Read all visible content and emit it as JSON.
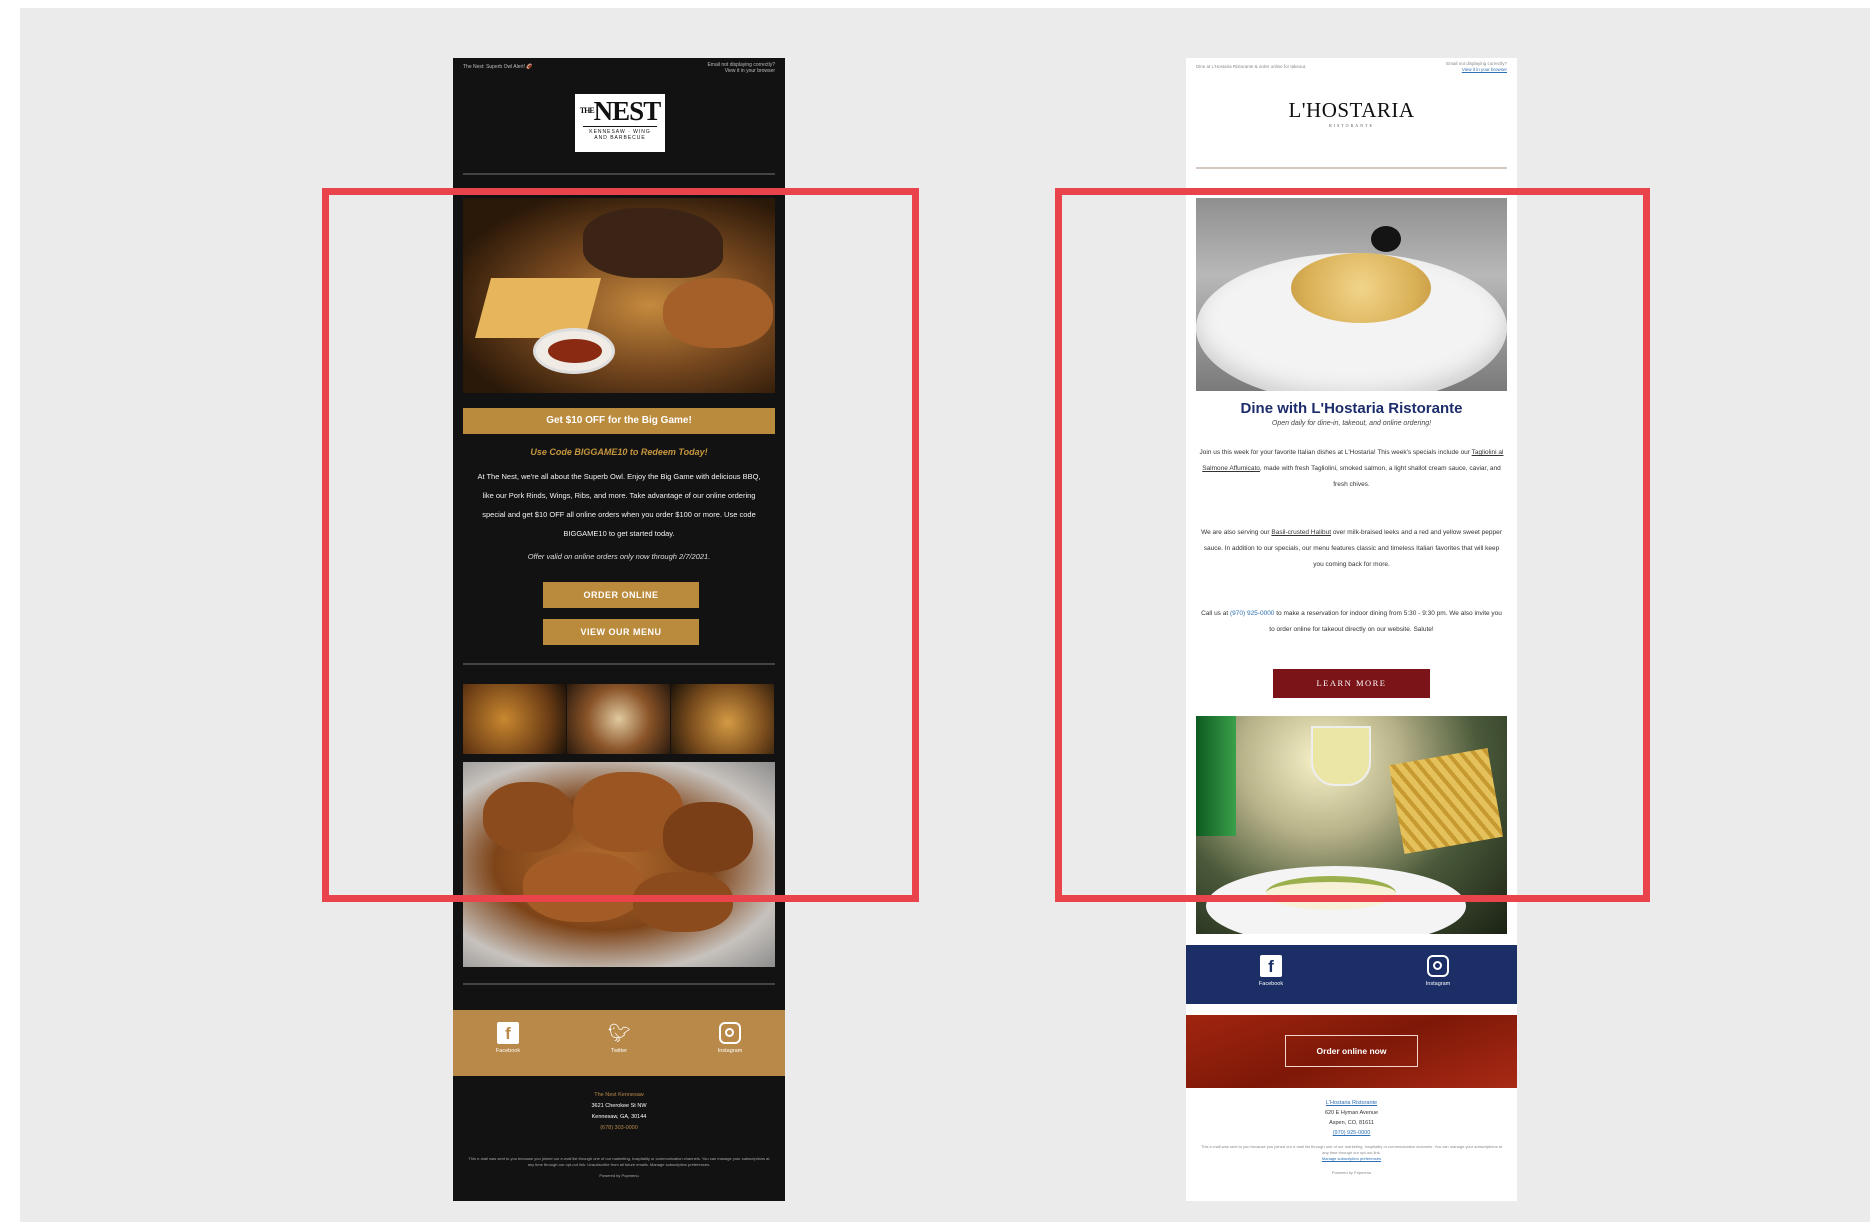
{
  "colors": {
    "background": "#ebebeb",
    "nest_bg": "#121212",
    "nest_gold": "#bb8b3d",
    "host_navy": "#1b2f66",
    "host_maroon": "#7a1419",
    "highlight_frame": "#e9434c"
  },
  "nest": {
    "preheader_left": "The Nest: Superb Owl Alert! 🏈",
    "preheader_right_1": "Email not displaying correctly?",
    "preheader_right_2": "View it in your browser",
    "logo_main": "NEST",
    "logo_the": "THE",
    "logo_sub": "KENNESAW · WING AND BARBECUE",
    "promo_bar": "Get $10 OFF for the Big Game!",
    "code_line": "Use Code BIGGAME10 to Redeem Today!",
    "body": "At The Nest, we're all about the Superb Owl. Enjoy the Big Game with delicious BBQ, like our Pork Rinds, Wings, Ribs, and more. Take advantage of our online ordering special and get $10 OFF all online orders when you order $100 or more. Use code BIGGAME10 to get started today.",
    "offer": "Offer valid on online orders only now through 2/7/2021.",
    "buttons": {
      "order": "ORDER ONLINE",
      "menu": "VIEW OUR MENU"
    },
    "social": {
      "facebook": "Facebook",
      "twitter": "Twitter",
      "instagram": "Instagram"
    },
    "footer": {
      "name": "The Nest Kennesaw",
      "address_1": "3621 Cherokee St NW",
      "address_2": "Kennesaw, GA, 30144",
      "phone": "(678) 303-0000"
    },
    "legal": "This e-mail was sent to you because you joined our e-mail list through one of our marketing, hospitality or communication channels. You can manage your subscriptions at any time through our opt-out link. Unsubscribe from all future emails. Manage subscription preferences.",
    "powered": "Powered by Popmenu"
  },
  "hostaria": {
    "preheader_left": "Dine at L'Hostaria Ristorante & order online for takeout.",
    "preheader_right_1": "Email not displaying correctly?",
    "preheader_right_2": "View it in your browser",
    "logo_name": "L'HOSTARIA",
    "logo_sub": "RISTORANTE",
    "title": "Dine with L'Hostaria Ristorante",
    "subtitle": "Open daily for dine-in, takeout, and online ordering!",
    "p1_a": "Join us this week for your favorite Italian dishes at L'Hostaria! This week's specials include our ",
    "p1_link": "Tagliolini al Salmone Affumicato",
    "p1_b": ", made with fresh Tagliolini, smoked salmon, a light shallot cream sauce, caviar, and fresh chives.",
    "p2_a": "We are also serving our ",
    "p2_link": "Basil-crusted Halibut",
    "p2_b": " over milk-braised leeks and a red and yellow sweet pepper sauce. In addition to our specials, our menu features classic and timeless Italian favorites that will keep you coming back for more.",
    "p3_a": "Call us at ",
    "p3_phone": "(970) 925-0000",
    "p3_b": " to make a reservation for indoor dining from 5:30 - 9:30 pm. We also invite you to order online for takeout directly on our website. Salute!",
    "learn_more": "LEARN MORE",
    "social": {
      "facebook": "Facebook",
      "instagram": "Instagram"
    },
    "order_button": "Order online now",
    "footer": {
      "name": "L'Hostaria Ristorante",
      "address_1": "620 E Hyman Avenue",
      "address_2": "Aspen, CO, 81611",
      "phone": "(970) 925-0000"
    },
    "legal": "This e-mail was sent to you because you joined our e-mail list through one of our marketing, hospitality or communication channels. You can manage your subscriptions at any time through our opt-out link.",
    "legal_link": "Manage subscription preferences",
    "powered": "Powered by Popmenu"
  }
}
